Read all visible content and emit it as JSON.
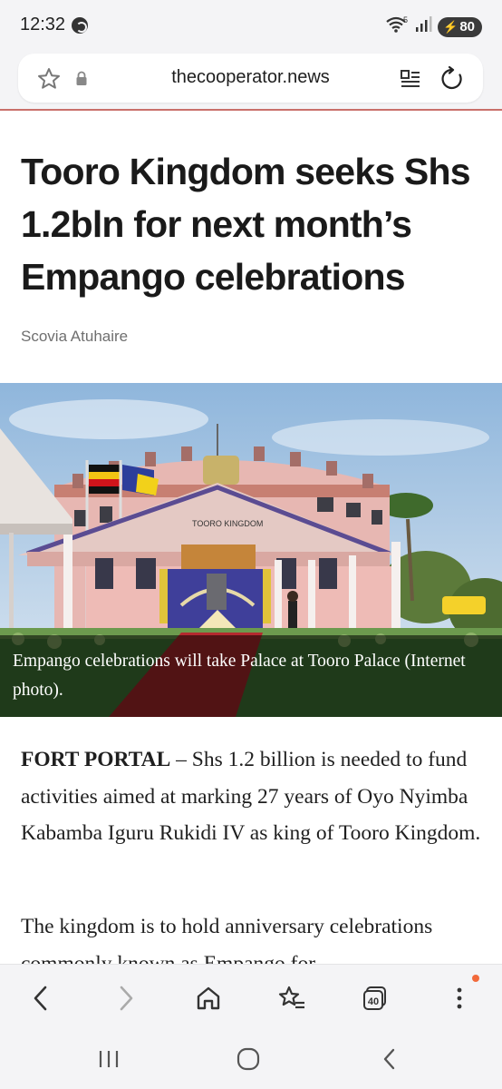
{
  "status_bar": {
    "time": "12:32",
    "battery": "80",
    "network": "5"
  },
  "browser": {
    "url": "thecooperator.news",
    "tab_count": "40",
    "accent_color": "#c9706a",
    "notification_color": "#f26a3b"
  },
  "article": {
    "headline": "Tooro Kingdom seeks Shs 1.2bln for next month’s Empango celebrations",
    "author": "Scovia Atuhaire",
    "image_caption": "Empango celebrations will take Palace at Tooro Palace (Internet photo).",
    "palace_sign": "TOORO KINGDOM",
    "para1_lead": "FORT PORTAL",
    "para1_rest": " – Shs 1.2 billion is needed to fund activities aimed at marking  27 years of Oyo Nyimba Kabamba Iguru Rukidi IV as king of Tooro Kingdom.",
    "para2": "The kingdom is to hold anniversary celebrations commonly known as Empango for"
  },
  "icons": {
    "status": [
      "shazam-icon",
      "wifi-icon",
      "signal-icon",
      "battery-icon"
    ],
    "url_bar": [
      "bookmark-star-icon",
      "lock-icon",
      "reader-mode-icon",
      "reload-icon"
    ],
    "toolbar": [
      "back-icon",
      "forward-icon",
      "home-icon",
      "bookmarks-icon",
      "tabs-icon",
      "menu-icon"
    ],
    "nav": [
      "recent-apps-icon",
      "home-circle-icon",
      "system-back-icon"
    ]
  }
}
